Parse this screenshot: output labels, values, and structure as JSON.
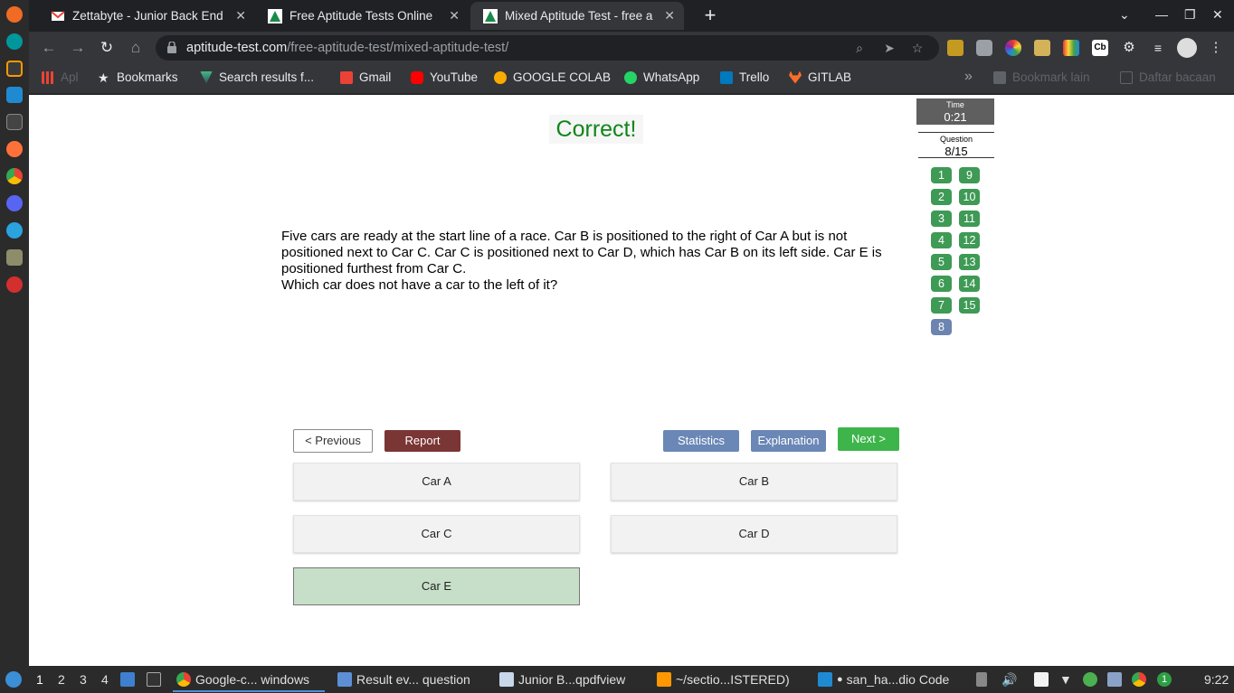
{
  "browser": {
    "tabs": [
      {
        "title": "Zettabyte - Junior Back End",
        "favicon": "gmail-icon",
        "active": false
      },
      {
        "title": "Free Aptitude Tests Online",
        "favicon": "aptitude-icon",
        "active": false
      },
      {
        "title": "Mixed Aptitude Test - free a",
        "favicon": "aptitude-icon",
        "active": true
      }
    ],
    "url_domain": "aptitude-test.com",
    "url_path": "/free-aptitude-test/mixed-aptitude-test/",
    "bookmarks": [
      {
        "label": "Apl",
        "icon": "apps-grid-icon"
      },
      {
        "label": "Bookmarks",
        "icon": "star-icon"
      },
      {
        "label": "Search results f...",
        "icon": "vue-icon"
      },
      {
        "label": "Gmail",
        "icon": "gmail-icon"
      },
      {
        "label": "YouTube",
        "icon": "youtube-icon"
      },
      {
        "label": "GOOGLE COLAB",
        "icon": "colab-icon"
      },
      {
        "label": "WhatsApp",
        "icon": "whatsapp-icon"
      },
      {
        "label": "Trello",
        "icon": "trello-icon"
      },
      {
        "label": "GITLAB",
        "icon": "gitlab-icon"
      }
    ],
    "bookmarks_overflow": "»",
    "other_bookmarks": "Bookmark lain",
    "reading_list": "Daftar bacaan"
  },
  "quiz": {
    "result": "Correct!",
    "question_lines": [
      "Five cars are ready at the start line of a race. Car B is positioned to the right of Car A but is not",
      "positioned next to Car C. Car C is positioned next to Car D, which has Car B on its left side. Car E is",
      "positioned furthest from Car C.",
      "Which car does not have a car to the left of it?"
    ],
    "time_label": "Time",
    "time_value": "0:21",
    "question_label": "Question",
    "question_value": "8/15",
    "question_numbers": [
      "1",
      "2",
      "3",
      "4",
      "5",
      "6",
      "7",
      "8",
      "9",
      "10",
      "11",
      "12",
      "13",
      "14",
      "15"
    ],
    "current_question": "8",
    "buttons": {
      "previous": "<  Previous",
      "report": "Report",
      "statistics": "Statistics",
      "explanation": "Explanation",
      "next": "Next  >"
    },
    "answers": [
      "Car A",
      "Car B",
      "Car C",
      "Car D",
      "Car E"
    ],
    "correct_answer": "Car E"
  },
  "taskbar": {
    "workspaces": [
      "1",
      "2",
      "3",
      "4"
    ],
    "apps": [
      {
        "label": "Google-c... windows",
        "icon": "chrome-icon"
      },
      {
        "label": "Result ev... question",
        "icon": "folder-icon"
      },
      {
        "label": "Junior B...qpdfview",
        "icon": "pdf-icon"
      },
      {
        "label": "~/sectio...ISTERED)",
        "icon": "sublime-icon"
      },
      {
        "label": "san_ha...dio Code",
        "icon": "vscode-icon"
      }
    ],
    "notification_count": "1",
    "clock": "9:22"
  }
}
